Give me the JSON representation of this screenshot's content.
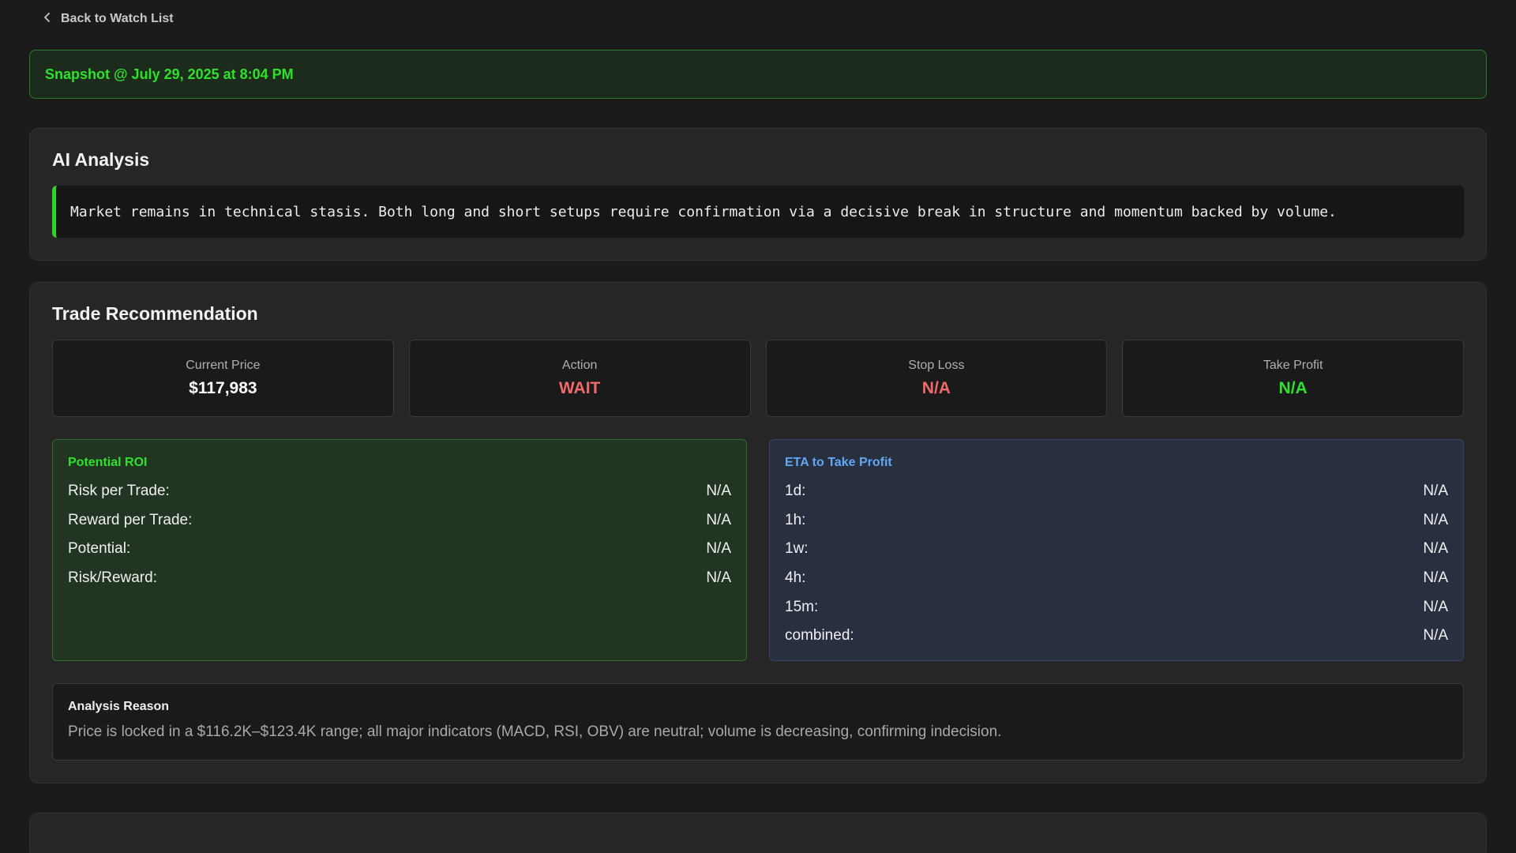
{
  "nav": {
    "back_label": "Back to Watch List"
  },
  "snapshot": {
    "label": "Snapshot @ July 29, 2025 at 8:04 PM"
  },
  "ai_analysis": {
    "title": "AI Analysis",
    "text": "Market remains in technical stasis. Both long and short setups require confirmation via a decisive break in structure and momentum backed by volume."
  },
  "trade": {
    "title": "Trade Recommendation",
    "stats": [
      {
        "label": "Current Price",
        "value": "$117,983",
        "color": "#ffffff"
      },
      {
        "label": "Action",
        "value": "WAIT",
        "color": "#f06a6a"
      },
      {
        "label": "Stop Loss",
        "value": "N/A",
        "color": "#f06a6a"
      },
      {
        "label": "Take Profit",
        "value": "N/A",
        "color": "#2ee22b"
      }
    ],
    "roi": {
      "title": "Potential ROI",
      "rows": [
        {
          "label": "Risk per Trade:",
          "value": "N/A"
        },
        {
          "label": "Reward per Trade:",
          "value": "N/A"
        },
        {
          "label": "Potential:",
          "value": "N/A"
        },
        {
          "label": "Risk/Reward:",
          "value": "N/A"
        }
      ]
    },
    "eta": {
      "title": "ETA to Take Profit",
      "rows": [
        {
          "label": "1d:",
          "value": "N/A"
        },
        {
          "label": "1h:",
          "value": "N/A"
        },
        {
          "label": "1w:",
          "value": "N/A"
        },
        {
          "label": "4h:",
          "value": "N/A"
        },
        {
          "label": "15m:",
          "value": "N/A"
        },
        {
          "label": "combined:",
          "value": "N/A"
        }
      ]
    },
    "reason": {
      "title": "Analysis Reason",
      "text": "Price is locked in a $116.2K–$123.4K range; all major indicators (MACD, RSI, OBV) are neutral; volume is decreasing, confirming indecision."
    }
  },
  "colors": {
    "accent_green": "#2ee22b",
    "accent_red": "#f06a6a",
    "accent_blue": "#62a7f5",
    "background": "#1b1b1b"
  }
}
